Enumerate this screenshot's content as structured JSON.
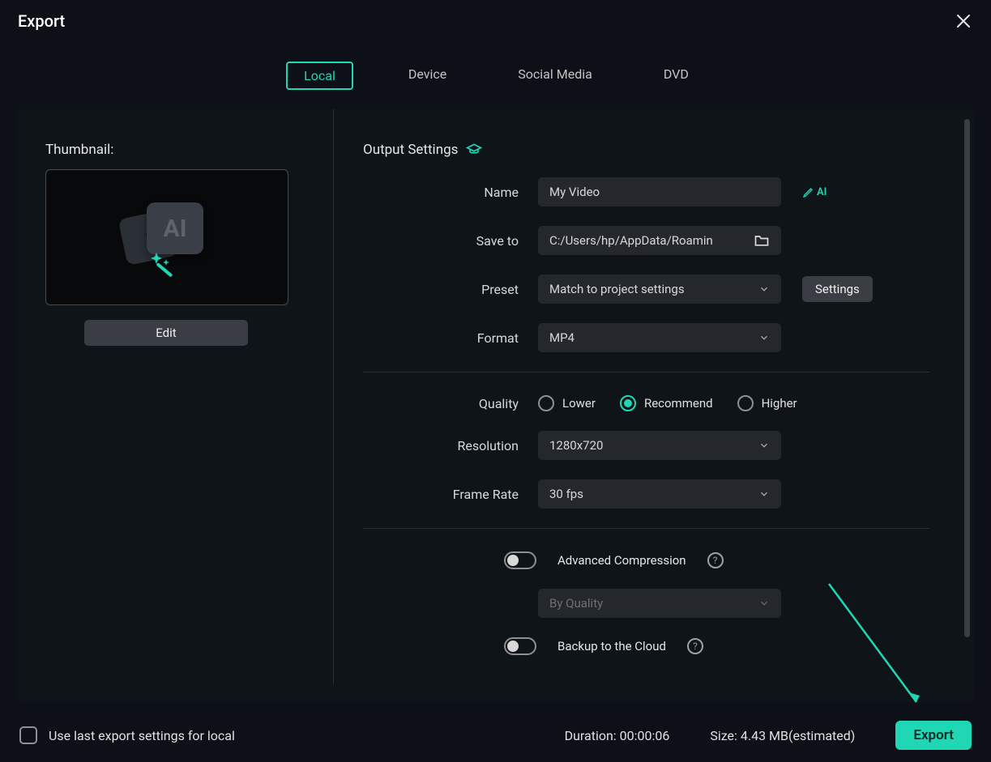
{
  "dialog": {
    "title": "Export"
  },
  "tabs": {
    "local": "Local",
    "device": "Device",
    "social": "Social Media",
    "dvd": "DVD"
  },
  "thumbnail": {
    "label": "Thumbnail:",
    "edit": "Edit"
  },
  "output": {
    "section": "Output Settings",
    "name_label": "Name",
    "name_value": "My Video",
    "ai_label": "AI",
    "save_label": "Save to",
    "save_value": "C:/Users/hp/AppData/Roamin",
    "preset_label": "Preset",
    "preset_value": "Match to project settings",
    "settings_btn": "Settings",
    "format_label": "Format",
    "format_value": "MP4",
    "quality_label": "Quality",
    "quality_lower": "Lower",
    "quality_recommend": "Recommend",
    "quality_higher": "Higher",
    "resolution_label": "Resolution",
    "resolution_value": "1280x720",
    "framerate_label": "Frame Rate",
    "framerate_value": "30 fps",
    "advcomp_label": "Advanced Compression",
    "advcomp_mode": "By Quality",
    "backup_label": "Backup to the Cloud"
  },
  "footer": {
    "use_last": "Use last export settings for local",
    "duration_label": "Duration:",
    "duration_value": "00:00:06",
    "size_label": "Size:",
    "size_value": "4.43 MB(estimated)",
    "export": "Export"
  }
}
